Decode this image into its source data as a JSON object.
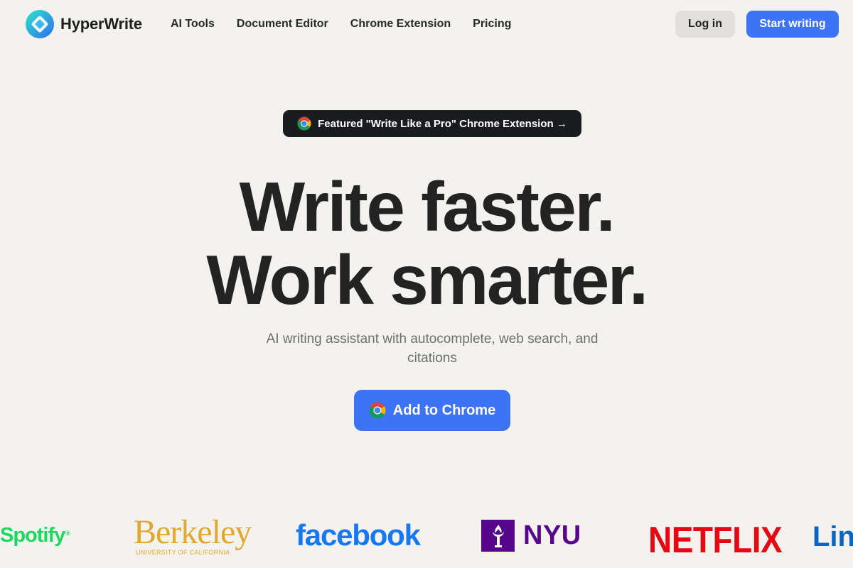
{
  "nav": {
    "brand": "HyperWrite",
    "links": [
      "AI Tools",
      "Document Editor",
      "Chrome Extension",
      "Pricing"
    ],
    "login_label": "Log in",
    "start_label": "Start writing"
  },
  "featured": {
    "label": "Featured \"Write Like a Pro\" Chrome Extension →",
    "icon": "chrome-icon"
  },
  "hero": {
    "title_line1": "Write faster.",
    "title_line2": "Work smarter.",
    "subtitle": "AI writing assistant with autocomplete, web search, and citations",
    "cta_label": "Add to Chrome"
  },
  "logos": {
    "spotify": "Spotify",
    "berkeley_name": "Berkeley",
    "berkeley_sub": "UNIVERSITY OF CALIFORNIA",
    "facebook": "facebook",
    "nyu": "NYU",
    "netflix": "NETFLIX",
    "linkedin": "Lin"
  },
  "colors": {
    "background": "#f3f2ef",
    "accent": "#3d73f5",
    "dark_pill": "#1b1c1f",
    "spotify": "#1ed760",
    "berkeley": "#e0a82e",
    "facebook": "#1877f2",
    "nyu": "#57068c",
    "netflix": "#e50914",
    "linkedin": "#0a66c2"
  }
}
